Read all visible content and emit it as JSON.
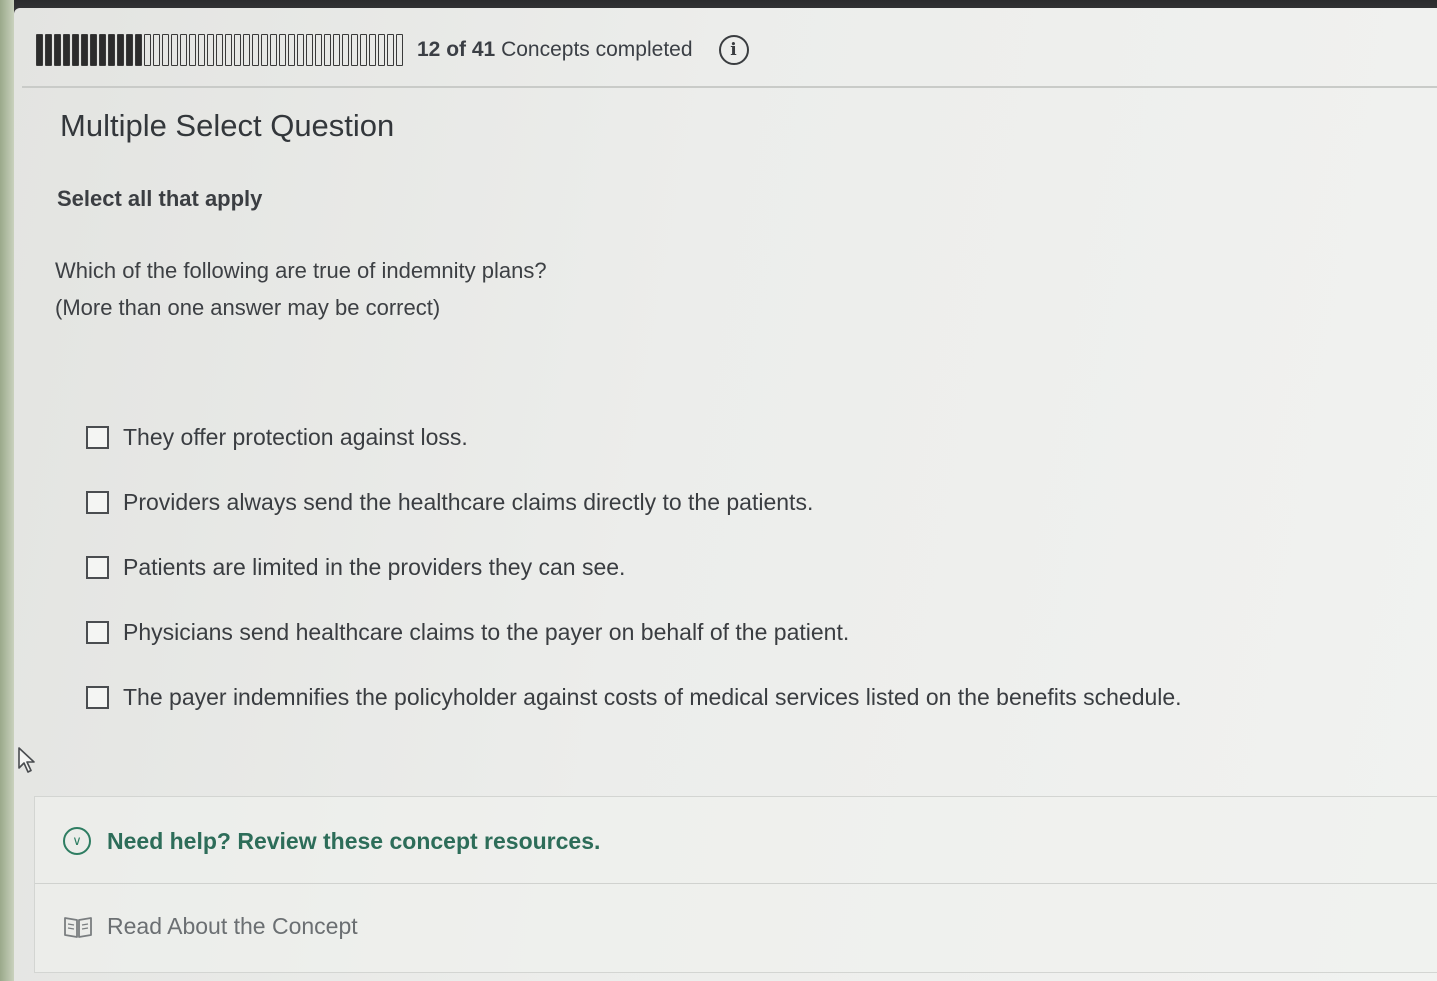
{
  "progress": {
    "current": "12",
    "of_word": "of",
    "total": "41",
    "label": "Concepts completed",
    "segments_completed": 12,
    "segments_total": 41
  },
  "question": {
    "type_label": "Multiple Select Question",
    "instruction": "Select all that apply",
    "prompt": "Which of the following are true of indemnity plans?",
    "note": "(More than one answer may be correct)",
    "options": [
      {
        "label": "They offer protection against loss.",
        "checked": false
      },
      {
        "label": "Providers always send the healthcare claims directly to the patients.",
        "checked": false
      },
      {
        "label": "Patients are limited in the providers they can see.",
        "checked": false
      },
      {
        "label": "Physicians send healthcare claims to the payer on behalf of the patient.",
        "checked": false
      },
      {
        "label": "The payer indemnifies the policyholder against costs of medical services listed on the benefits schedule.",
        "checked": false
      }
    ]
  },
  "help": {
    "title": "Need help? Review these concept resources.",
    "resource_label": "Read About the Concept"
  },
  "icons": {
    "info": "info-icon",
    "expand": "chevron-down-icon",
    "resource": "book-icon",
    "cursor": "mouse-pointer-icon"
  },
  "colors": {
    "help_accent": "#2d6d59",
    "progress_fill": "#2c2c2c"
  }
}
